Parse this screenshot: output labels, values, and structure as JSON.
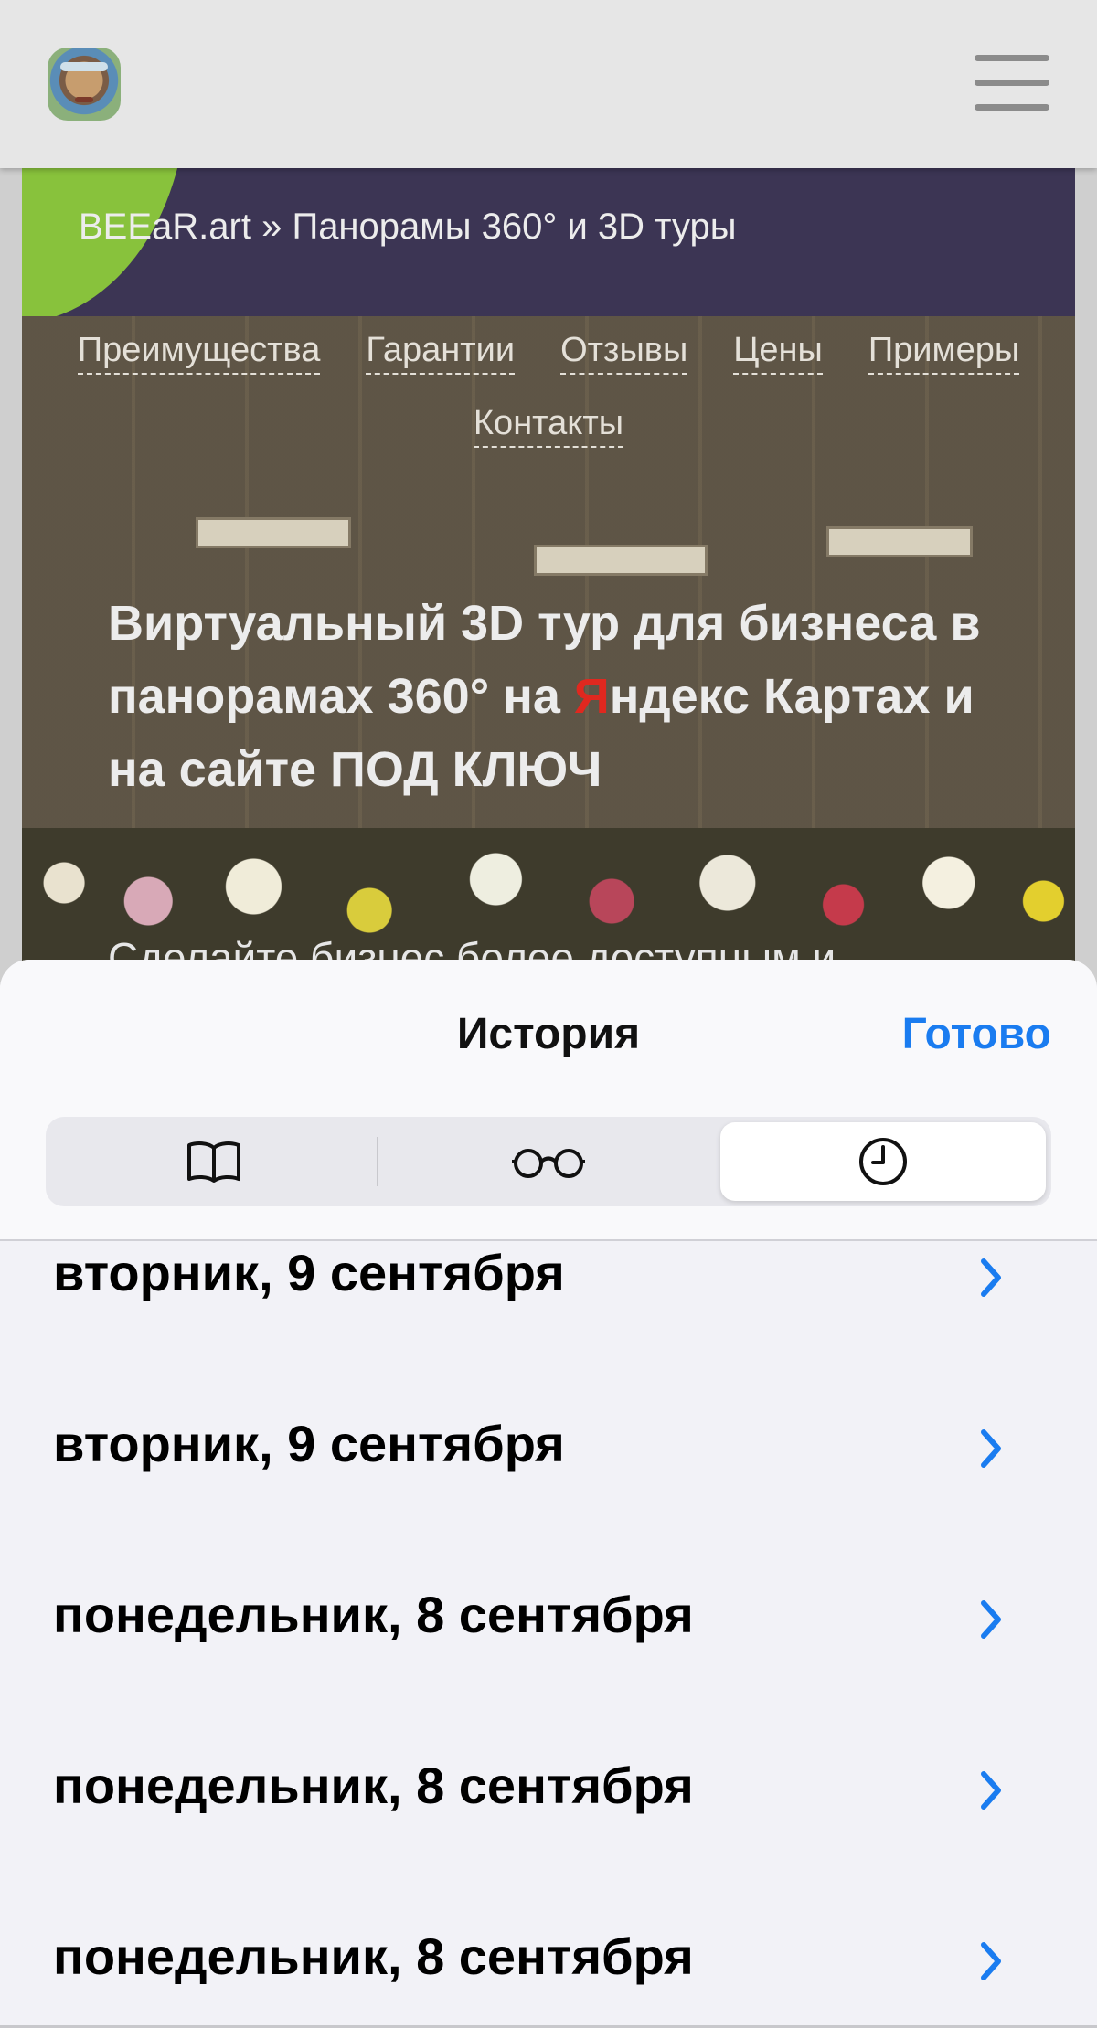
{
  "header": {
    "logo_icon": "avatar-logo-icon",
    "menu_icon": "hamburger-menu-icon"
  },
  "breadcrumb": "BEEaR.art » Панорамы 360° и 3D туры",
  "nav": {
    "row1": [
      "Преимущества",
      "Гарантии",
      "Отзывы",
      "Цены",
      "Примеры"
    ],
    "row2": [
      "Контакты"
    ]
  },
  "hero": {
    "title_part1": "Виртуальный 3D тур для бизнеса в панорамах 360° на ",
    "title_highlight": "Я",
    "title_part2": "ндекс Картах и на сайте ПОД КЛЮЧ",
    "subtitle": "Сделайте бизнес более доступным и"
  },
  "sheet": {
    "title": "История",
    "done_label": "Готово",
    "tabs": [
      {
        "icon": "book-icon"
      },
      {
        "icon": "reading-glasses-icon"
      },
      {
        "icon": "clock-icon",
        "selected": true
      }
    ],
    "items": [
      "вторник, 9 сентября",
      "вторник, 9 сентября",
      "понедельник, 8 сентября",
      "понедельник, 8 сентября",
      "понедельник, 8 сентября"
    ]
  },
  "colors": {
    "accent": "#1a7cf0",
    "yandex_red": "#e0281f",
    "breadcrumb_bg": "#3c3554",
    "green_arc": "#88c23c"
  }
}
